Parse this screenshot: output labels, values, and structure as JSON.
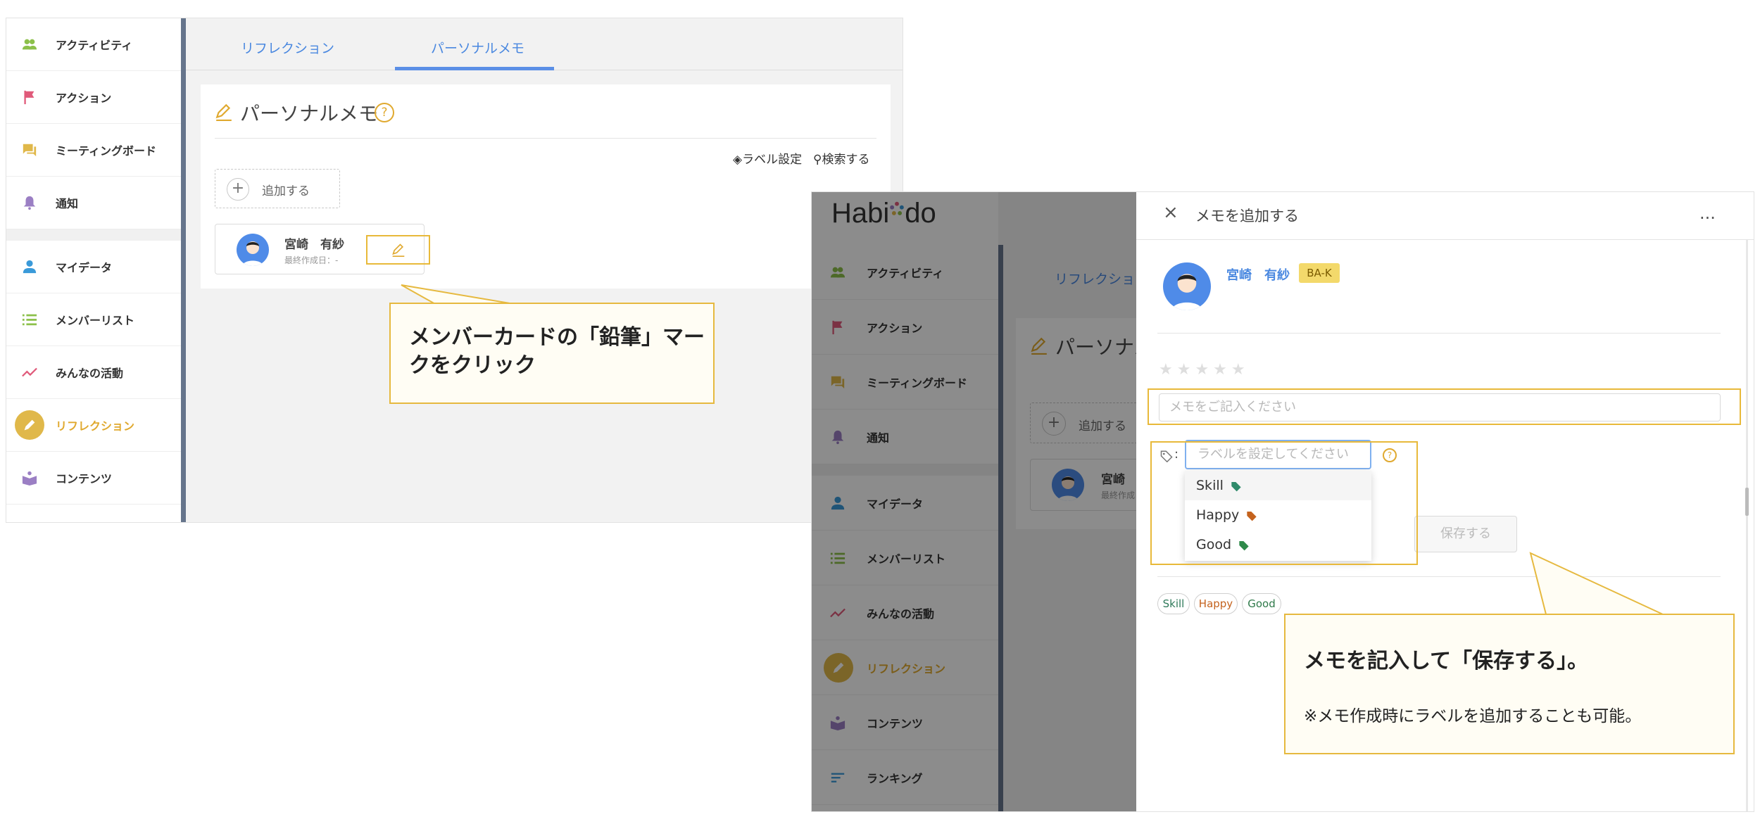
{
  "nav_items": [
    "アクティビティ",
    "アクション",
    "ミーティングボード",
    "通知",
    "マイデータ",
    "メンバーリスト",
    "みんなの活動",
    "リフレクション",
    "コンテンツ",
    "ランキング"
  ],
  "tabs": [
    "リフレクション",
    "パーソナルメモ"
  ],
  "tab_partial": "リフレクション",
  "page_title": "パーソナルメモ",
  "page_title_partial": "パーソナル",
  "help_mark": "?",
  "toolbar": {
    "label_settings": "ラベル設定",
    "search": "検索する"
  },
  "add_button": {
    "plus": "+",
    "label": "追加する"
  },
  "member": {
    "name": "宮崎　有紗",
    "name_partial": "宮崎",
    "sub": "最終作成日：-",
    "sub_partial": "最終作成日",
    "badge": "BA-K"
  },
  "callout1": "メンバーカードの「鉛筆」マークをクリック",
  "logo": {
    "left": "Habi",
    "right": "do"
  },
  "drawer": {
    "close": "×",
    "title": "メモを追加する",
    "more": "...",
    "stars": "★★★★★",
    "memo_placeholder": "メモをご記入ください",
    "label_placeholder": "ラベルを設定してください",
    "label_colon": ":",
    "save": "保存する",
    "dropdown": [
      {
        "label": "Skill",
        "color": "#2f8a6a"
      },
      {
        "label": "Happy",
        "color": "#c4621d"
      },
      {
        "label": "Good",
        "color": "#2f8a4a"
      }
    ],
    "tags": [
      {
        "label": "Skill",
        "color": "#2f7a5a"
      },
      {
        "label": "Happy",
        "color": "#c4621d"
      },
      {
        "label": "Good",
        "color": "#2f7a4a"
      }
    ]
  },
  "callout2": {
    "title": "メモを記入して「保存する」。",
    "note": "※メモ作成時にラベルを追加することも可能。"
  },
  "colors": {
    "accent_blue": "#4a88e0",
    "accent_yellow": "#e6b93f",
    "sidebar_rule": "#66758c"
  }
}
